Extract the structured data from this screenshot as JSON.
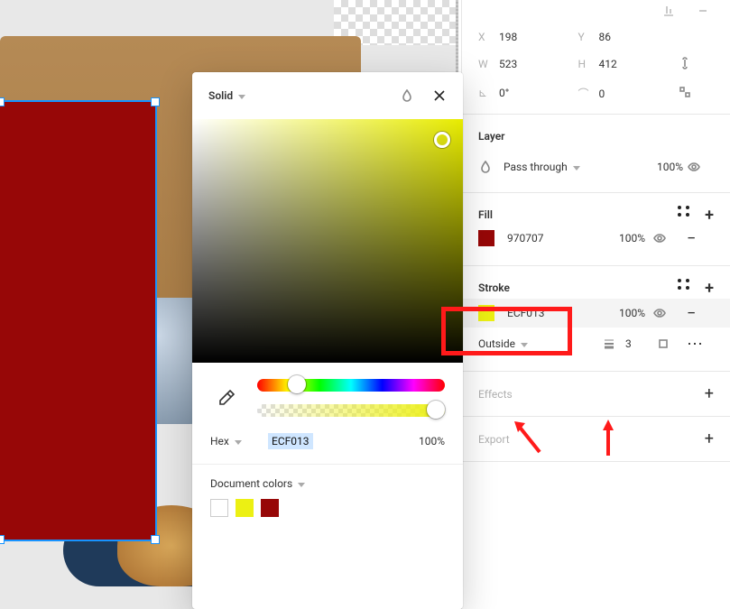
{
  "transform": {
    "x_label": "X",
    "x": "198",
    "y_label": "Y",
    "y": "86",
    "w_label": "W",
    "w": "523",
    "h_label": "H",
    "h": "412",
    "rot_label": "⊾",
    "rot": "0°",
    "radius_label": "⌒",
    "radius": "0"
  },
  "layer": {
    "heading": "Layer",
    "blend": "Pass through",
    "opacity": "100%"
  },
  "fill": {
    "heading": "Fill",
    "hex": "970707",
    "opacity": "100%"
  },
  "stroke": {
    "heading": "Stroke",
    "hex": "ECF013",
    "opacity": "100%",
    "position": "Outside",
    "weight": "3"
  },
  "effects": {
    "heading": "Effects"
  },
  "export": {
    "heading": "Export"
  },
  "picker": {
    "mode": "Solid",
    "hex_label": "Hex",
    "hex": "ECF013",
    "opacity": "100%",
    "doc_colors_label": "Document colors",
    "doc_colors": [
      "#ffffff",
      "#ecf013",
      "#970707"
    ]
  },
  "chart_data": null
}
